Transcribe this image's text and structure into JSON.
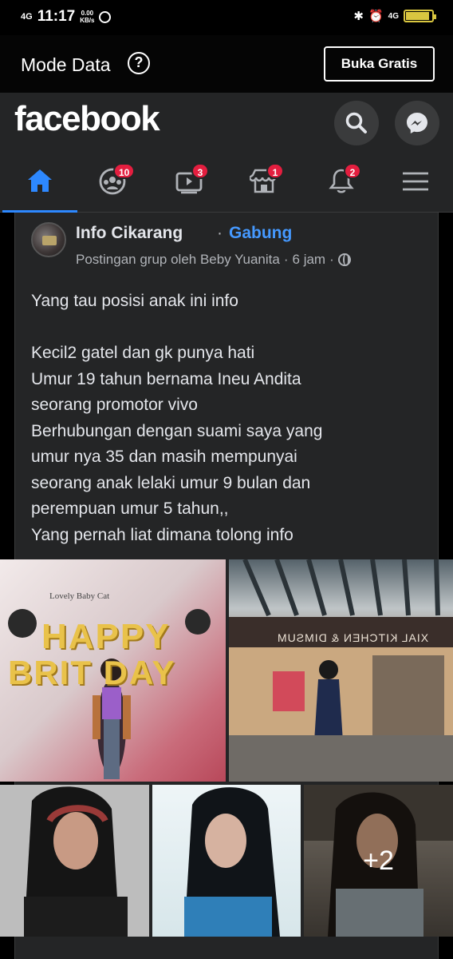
{
  "status_bar": {
    "signal": "4G",
    "time": "11:17",
    "speed_value": "0.00",
    "speed_unit": "KB/s",
    "network_right": "4G",
    "battery_level": 0.9
  },
  "mode_bar": {
    "label": "Mode Data",
    "help_symbol": "?",
    "button_label": "Buka Gratis"
  },
  "header": {
    "logo": "facebook",
    "nav": [
      {
        "name": "home",
        "badge": ""
      },
      {
        "name": "groups",
        "badge": "10"
      },
      {
        "name": "watch",
        "badge": "3"
      },
      {
        "name": "marketplace",
        "badge": "1"
      },
      {
        "name": "notifications",
        "badge": "2"
      },
      {
        "name": "menu",
        "badge": ""
      }
    ]
  },
  "post": {
    "group_name": "Info Cikarang",
    "separator": "·",
    "join_label": "Gabung",
    "meta_prefix": "Postingan grup oleh Beby Yuanita",
    "meta_dot": "·",
    "meta_time": "6 jam",
    "meta_dot2": "·",
    "text_lines": [
      "Yang tau posisi anak ini info",
      "",
      "Kecil2 gatel dan gk punya hati",
      "Umur 19 tahun bernama Ineu Andita",
      "seorang promotor vivo",
      "Berhubungan dengan suami saya yang",
      "umur nya 35 dan masih mempunyai",
      "seorang anak lelaki umur 9 bulan dan",
      "perempuan umur 5 tahun,,",
      "Yang pernah liat dimana tolong info"
    ],
    "photo_1_text_top": "Lovely  Baby  Cat",
    "photo_1_happy": "HAPPY",
    "photo_1_birthday": "BRIT DAY",
    "photo_2_sign": "XIAL KITCHEN & DIMSUM",
    "more_photos": "+2"
  },
  "colors": {
    "accent": "#2d88ff",
    "badge": "#e41e3f",
    "surface": "#242526",
    "link": "#4599ff"
  }
}
